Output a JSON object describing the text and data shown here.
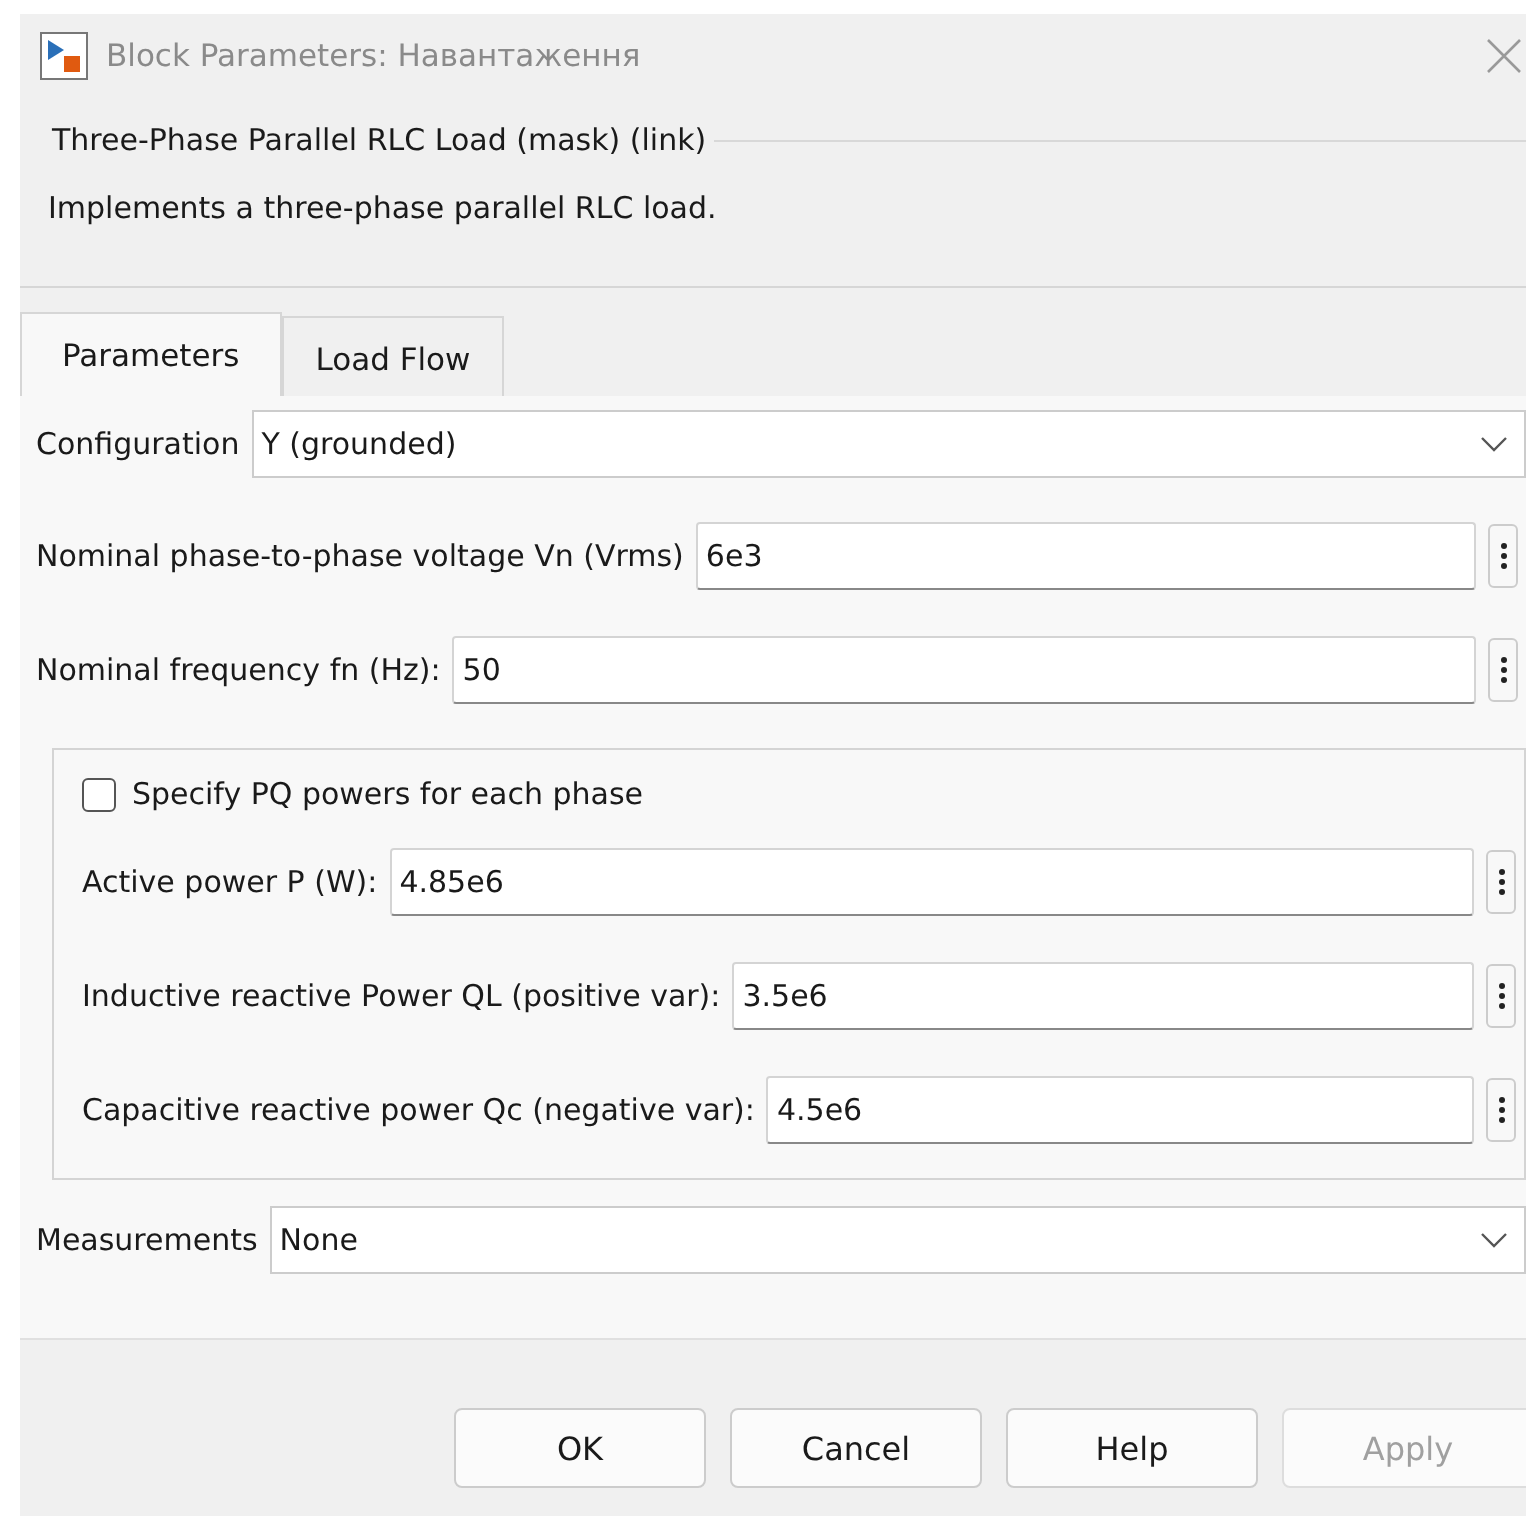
{
  "window": {
    "title": "Block Parameters: Навантаження"
  },
  "mask": {
    "title": "Three-Phase Parallel RLC Load (mask) (link)",
    "description": "Implements a three-phase parallel RLC load."
  },
  "tabs": [
    {
      "label": "Parameters",
      "selected": true
    },
    {
      "label": "Load Flow",
      "selected": false
    }
  ],
  "parameters": [
    {
      "kind": "dropdown",
      "label": "Configuration",
      "value": "Y (grounded)"
    },
    {
      "kind": "edit",
      "label": "Nominal phase-to-phase voltage Vn (Vrms)",
      "value": "6e3"
    },
    {
      "kind": "edit",
      "label": "Nominal frequency fn (Hz):",
      "value": "50"
    }
  ],
  "group": {
    "checkbox": {
      "label": "Specify PQ powers for each phase",
      "checked": false
    },
    "parameters": [
      {
        "kind": "edit",
        "label": "Active power P (W):",
        "value": "4.85e6"
      },
      {
        "kind": "edit",
        "label": "Inductive reactive Power QL (positive var):",
        "value": "3.5e6"
      },
      {
        "kind": "edit",
        "label": "Capacitive reactive power Qc (negative var):",
        "value": "4.5e6"
      }
    ]
  },
  "after_group": [
    {
      "kind": "dropdown",
      "label": "Measurements",
      "value": "None"
    }
  ],
  "buttons": [
    {
      "label": "OK",
      "disabled": false
    },
    {
      "label": "Cancel",
      "disabled": false
    },
    {
      "label": "Help",
      "disabled": false
    },
    {
      "label": "Apply",
      "disabled": true
    }
  ]
}
